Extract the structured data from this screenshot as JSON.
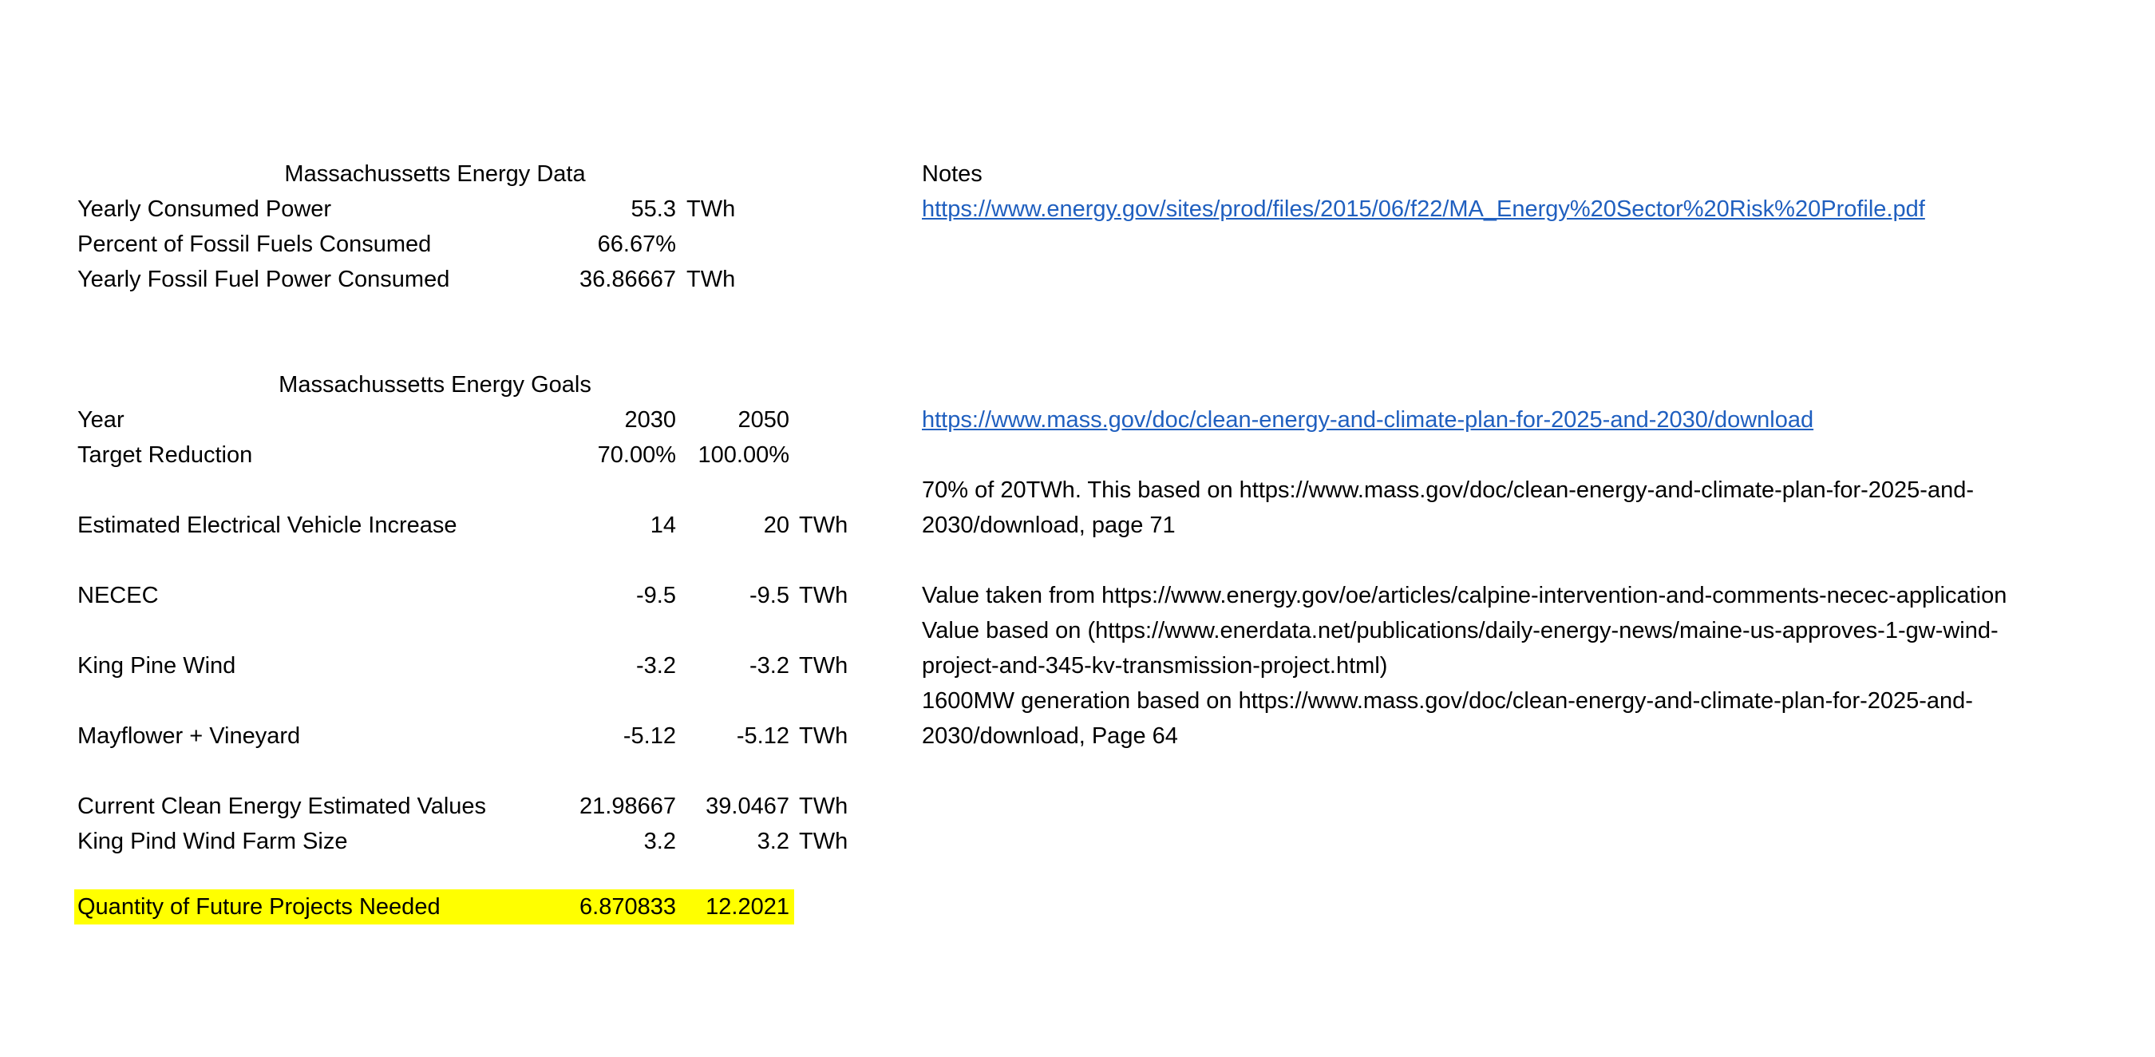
{
  "energy_data": {
    "title": "Massachussetts Energy Data",
    "rows": [
      {
        "label": "Yearly Consumed Power",
        "value": "55.3",
        "unit": "TWh"
      },
      {
        "label": "Percent of Fossil Fuels Consumed",
        "value": "66.67%",
        "unit": ""
      },
      {
        "label": "Yearly Fossil Fuel Power Consumed",
        "value": "36.86667",
        "unit": "TWh"
      }
    ]
  },
  "energy_goals": {
    "title": "Massachussetts Energy Goals",
    "rows": [
      {
        "label": "Year",
        "v2030": "2030",
        "v2050": "2050",
        "unit": ""
      },
      {
        "label": "Target Reduction",
        "v2030": "70.00%",
        "v2050": "100.00%",
        "unit": ""
      },
      {
        "label": "Estimated Electrical Vehicle Increase",
        "v2030": "14",
        "v2050": "20",
        "unit": "TWh"
      },
      {
        "label": "NECEC",
        "v2030": "-9.5",
        "v2050": "-9.5",
        "unit": "TWh"
      },
      {
        "label": "King Pine Wind",
        "v2030": "-3.2",
        "v2050": "-3.2",
        "unit": "TWh"
      },
      {
        "label": "Mayflower + Vineyard",
        "v2030": "-5.12",
        "v2050": "-5.12",
        "unit": "TWh"
      },
      {
        "label": "Current Clean Energy Estimated Values",
        "v2030": "21.98667",
        "v2050": "39.0467",
        "unit": "TWh"
      },
      {
        "label": "King Pind Wind Farm Size",
        "v2030": "3.2",
        "v2050": "3.2",
        "unit": "TWh"
      },
      {
        "label": "Quantity of Future Projects Needed",
        "v2030": "6.870833",
        "v2050": "12.2021",
        "unit": ""
      }
    ]
  },
  "notes": {
    "header": "Notes",
    "link_energy_gov": "https://www.energy.gov/sites/prod/files/2015/06/f22/MA_Energy%20Sector%20Risk%20Profile.pdf",
    "link_mass_gov": "https://www.mass.gov/doc/clean-energy-and-climate-plan-for-2025-and-2030/download",
    "ev_note_line1": "70% of 20TWh. This based on https://www.mass.gov/doc/clean-energy-and-climate-plan-for-2025-and-",
    "ev_note_line2": "2030/download, page 71",
    "necec_note": "Value taken from https://www.energy.gov/oe/articles/calpine-intervention-and-comments-necec-application",
    "kingpine_note_line1": "Value based on (https://www.enerdata.net/publications/daily-energy-news/maine-us-approves-1-gw-wind-",
    "kingpine_note_line2": "project-and-345-kv-transmission-project.html)",
    "mayflower_note_line1": "1600MW generation based on https://www.mass.gov/doc/clean-energy-and-climate-plan-for-2025-and-",
    "mayflower_note_line2": "2030/download, Page 64"
  },
  "colors": {
    "highlight": "#ffff00",
    "link": "#1f5fbf"
  }
}
